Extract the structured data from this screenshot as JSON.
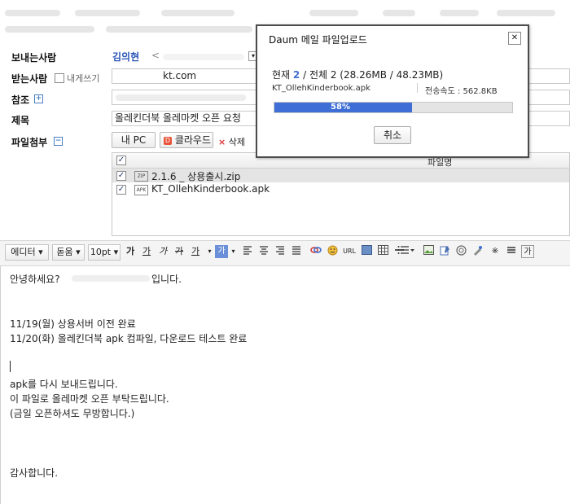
{
  "compose": {
    "sender_label": "보내는사람",
    "sender_name": "김의현",
    "sender_arrow": "<",
    "recipient_label": "받는사람",
    "self_send_label": "내게쓰기",
    "recipient_value": "kt.com",
    "cc_label": "참조",
    "subject_label": "제목",
    "subject_value": "올레킨더북 올레마켓 오픈 요청",
    "attach_label": "파일첨부",
    "my_pc_button": "내 PC",
    "cloud_button": "클라우드",
    "delete_button": "삭제",
    "file_header": "파일명",
    "files": [
      {
        "name": "2.1.6 _ 상용출시.zip",
        "icon": "zip",
        "checked": true
      },
      {
        "name": "KT_OllehKinderbook.apk",
        "icon": "apk",
        "checked": true
      }
    ]
  },
  "editor_toolbar": {
    "mode": "에디터",
    "font": "돋움",
    "size": "10pt",
    "bold": "가",
    "underline": "가",
    "italic": "가",
    "strike": "가",
    "color": "가",
    "bgcolor": "가",
    "url": "URL",
    "special": "※",
    "extra": "가"
  },
  "body_lines": [
    "안녕하세요?",
    "입니다.",
    "11/19(월) 상용서버 이전 완료",
    "11/20(화) 올레킨더북 apk 컴파일, 다운로드 테스트 완료",
    "apk를 다시 보내드립니다.",
    "이 파일로 올레마켓 오픈 부탁드립니다.",
    "(금일 오픈하셔도 무방합니다.)",
    "감사합니다."
  ],
  "dialog": {
    "title": "Daum 메일 파일업로드",
    "current_label": "현재",
    "current_num": "2",
    "total_text": "/ 전체 2 (28.26MB / 48.23MB)",
    "filename": "KT_OllehKinderbook.apk",
    "speed": "전송속도 : 562.8KB",
    "progress_label": "58%",
    "progress_value": 58,
    "cancel": "취소",
    "close": "✕"
  },
  "colors": {
    "progress": "#3f6fd6",
    "name_link": "#2a55b8"
  }
}
